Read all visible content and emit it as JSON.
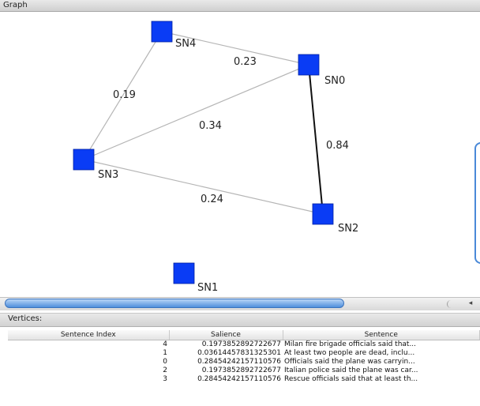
{
  "graph_panel": {
    "title": "Graph"
  },
  "graph": {
    "nodes": [
      {
        "id": "SN4",
        "label": "SN4"
      },
      {
        "id": "SN0",
        "label": "SN0"
      },
      {
        "id": "SN3",
        "label": "SN3"
      },
      {
        "id": "SN2",
        "label": "SN2"
      },
      {
        "id": "SN1",
        "label": "SN1"
      }
    ],
    "edges": [
      {
        "from": "SN4",
        "to": "SN0",
        "weight": "0.23"
      },
      {
        "from": "SN4",
        "to": "SN3",
        "weight": "0.19"
      },
      {
        "from": "SN3",
        "to": "SN0",
        "weight": "0.34"
      },
      {
        "from": "SN0",
        "to": "SN2",
        "weight": "0.84"
      },
      {
        "from": "SN3",
        "to": "SN2",
        "weight": "0.24"
      }
    ],
    "node_color": "#0a3cf5"
  },
  "vertices_panel": {
    "title": "Vertices:",
    "columns": [
      "Sentence Index",
      "Salience",
      "Sentence"
    ],
    "rows": [
      {
        "index": "4",
        "salience": "0.1973852892722677",
        "sentence": "Milan fire brigade officials said that..."
      },
      {
        "index": "1",
        "salience": "0.03614457831325301",
        "sentence": "At least two people are dead, inclu..."
      },
      {
        "index": "0",
        "salience": "0.28454242157110576",
        "sentence": "Officials said the plane was carryin..."
      },
      {
        "index": "2",
        "salience": "0.1973852892722677",
        "sentence": "Italian police said the plane was car..."
      },
      {
        "index": "3",
        "salience": "0.28454242157110576",
        "sentence": "Rescue officials said that at least th..."
      }
    ]
  }
}
